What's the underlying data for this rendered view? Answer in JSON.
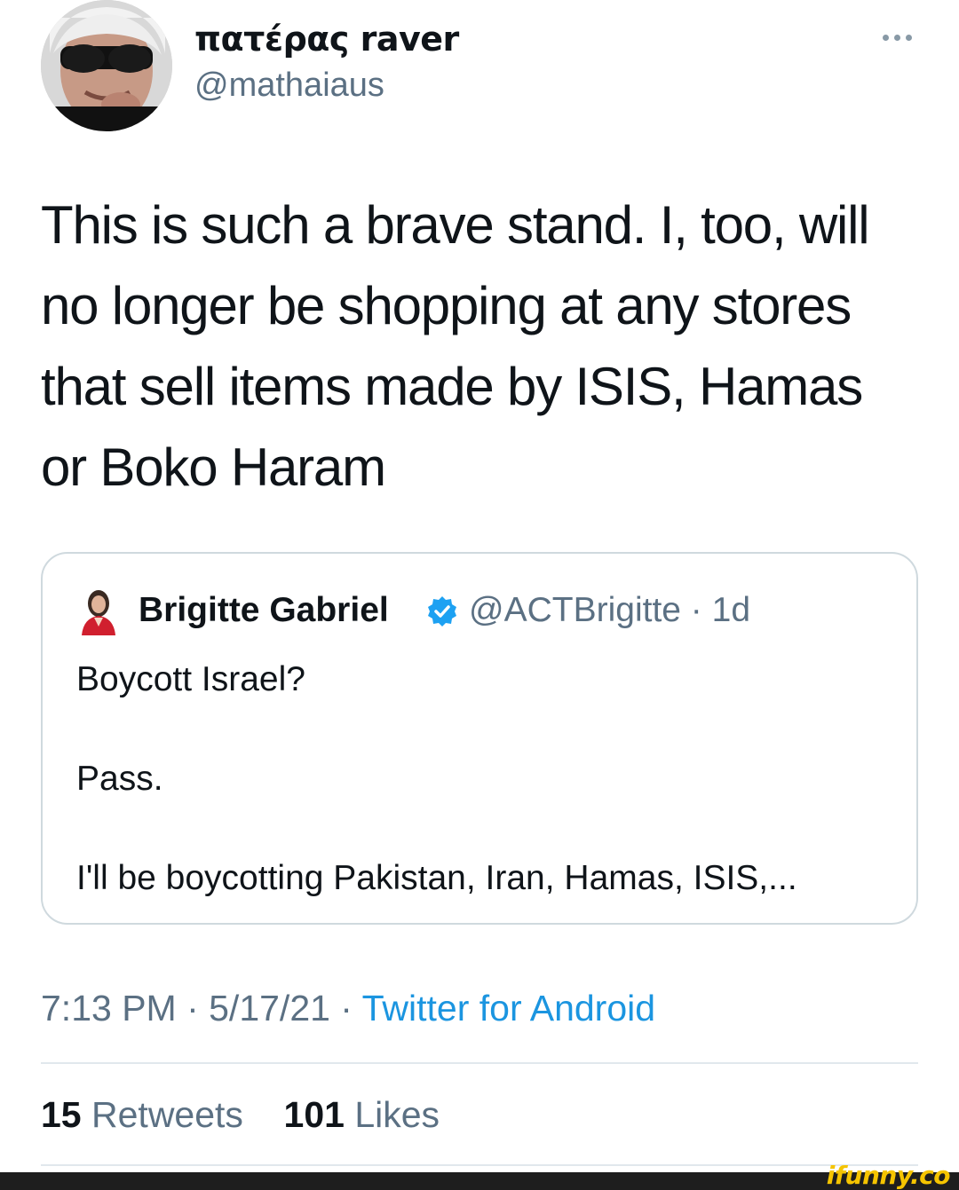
{
  "author": {
    "display_name": "πατέρας raver",
    "handle": "@mathaiaus"
  },
  "tweet": {
    "lines": [
      "This is such a brave stand. I, too, will",
      "no longer be shopping at any stores",
      "that sell items made by ISIS, Hamas",
      "or Boko Haram"
    ]
  },
  "quoted": {
    "name": "Brigitte Gabriel",
    "handle_time": "@ACTBrigitte · 1d",
    "lines": [
      "Boycott Israel?",
      "Pass.",
      "I'll be boycotting Pakistan, Iran, Hamas, ISIS,..."
    ]
  },
  "meta": {
    "time_date": "7:13 PM · 5/17/21 · ",
    "source": "Twitter for Android"
  },
  "stats": {
    "retweets_count": "15",
    "retweets_label": "Retweets",
    "likes_count": "101",
    "likes_label": "Likes"
  },
  "watermark": "ifunny.co",
  "colors": {
    "text_primary": "#0f1419",
    "text_secondary": "#5b7083",
    "link": "#1b95e0",
    "verified": "#1da1f2",
    "border": "#cfd9de",
    "watermark": "#f5c400"
  },
  "icons": {
    "more": "more-horizontal-icon",
    "verified": "verified-badge-icon"
  }
}
